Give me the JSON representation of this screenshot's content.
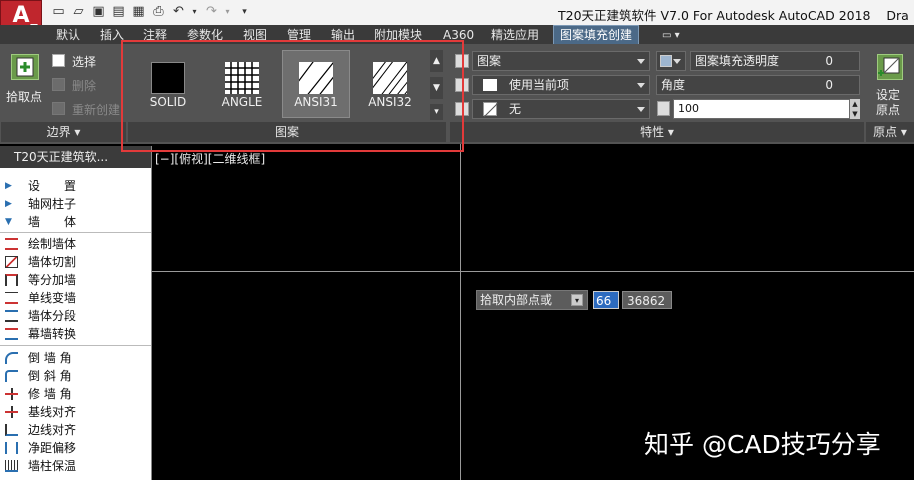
{
  "app": {
    "logo_letter": "A",
    "title": "T20天正建筑软件 V7.0 For Autodesk AutoCAD 2018",
    "title_cut": "Dra"
  },
  "tabs": [
    {
      "label": "默认"
    },
    {
      "label": "插入"
    },
    {
      "label": "注释"
    },
    {
      "label": "参数化"
    },
    {
      "label": "视图"
    },
    {
      "label": "管理"
    },
    {
      "label": "输出"
    },
    {
      "label": "附加模块"
    },
    {
      "label": "A360"
    },
    {
      "label": "精选应用"
    },
    {
      "label": "图案填充创建",
      "active": true
    }
  ],
  "ribbon": {
    "boundary": {
      "pick_points": "拾取点",
      "select": "选择",
      "remove": "删除",
      "recreate": "重新创建",
      "panel_label": "边界"
    },
    "pattern": {
      "swatches": [
        {
          "label": "SOLID"
        },
        {
          "label": "ANGLE"
        },
        {
          "label": "ANSI31"
        },
        {
          "label": "ANSI32"
        }
      ],
      "panel_label": "图案"
    },
    "properties": {
      "type": "图案",
      "color": "使用当前项",
      "background": "无",
      "transparency_label": "图案填充透明度",
      "transparency_value": "0",
      "angle_label": "角度",
      "angle_value": "0",
      "scale_value": "100",
      "panel_label": "特性"
    },
    "origin": {
      "set_origin_line1": "设定",
      "set_origin_line2": "原点",
      "panel_label": "原点"
    }
  },
  "palette": {
    "title": "T20天正建筑软...",
    "items": [
      {
        "label": "设　　置",
        "kind": "cat-closed"
      },
      {
        "label": "轴网柱子",
        "kind": "cat-closed"
      },
      {
        "label": "墙　　体",
        "kind": "cat-open"
      },
      {
        "label": "绘制墙体",
        "kind": "cmd"
      },
      {
        "label": "墙体切割",
        "kind": "cmd"
      },
      {
        "label": "等分加墙",
        "kind": "cmd"
      },
      {
        "label": "单线变墙",
        "kind": "cmd"
      },
      {
        "label": "墙体分段",
        "kind": "cmd"
      },
      {
        "label": "幕墙转换",
        "kind": "cmd"
      },
      {
        "label": "倒 墙 角",
        "kind": "cmd"
      },
      {
        "label": "倒 斜 角",
        "kind": "cmd"
      },
      {
        "label": "修 墙 角",
        "kind": "cmd"
      },
      {
        "label": "基线对齐",
        "kind": "cmd"
      },
      {
        "label": "边线对齐",
        "kind": "cmd"
      },
      {
        "label": "净距偏移",
        "kind": "cmd"
      },
      {
        "label": "墙柱保温",
        "kind": "cmd"
      }
    ]
  },
  "drawing": {
    "view_tag": "[−][俯视][二维线框]",
    "tooltip": "拾取内部点或",
    "coord_x": "66",
    "coord_y": "36862"
  },
  "watermark": "知乎 @CAD技巧分享",
  "colors": {
    "accent_red": "#e23a3a",
    "active_tab": "#4b6987",
    "ribbon_bg": "#535353"
  }
}
